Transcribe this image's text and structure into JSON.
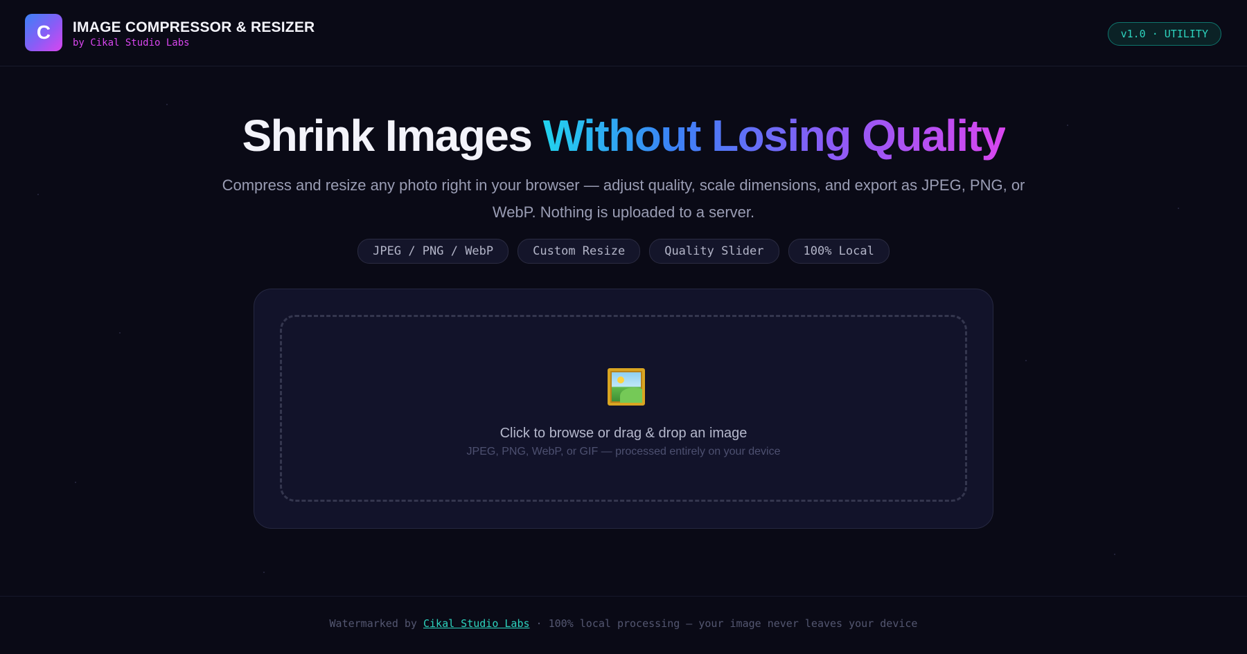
{
  "header": {
    "logo_letter": "C",
    "title": "IMAGE COMPRESSOR & RESIZER",
    "subtitle": "by Cikal Studio Labs",
    "version_badge": "v1.0 · UTILITY"
  },
  "hero": {
    "title_plain": "Shrink Images ",
    "title_gradient": "Without Losing Quality",
    "description": "Compress and resize any photo right in your browser — adjust quality, scale dimensions, and export as JPEG, PNG, or WebP. Nothing is uploaded to a server."
  },
  "features": [
    "JPEG / PNG / WebP",
    "Custom Resize",
    "Quality Slider",
    "100% Local"
  ],
  "dropzone": {
    "icon": "framed-picture-icon",
    "title": "Click to browse or drag & drop an image",
    "hint": "JPEG, PNG, WebP, or GIF — processed entirely on your device"
  },
  "footer": {
    "prefix": "Watermarked by ",
    "link_label": "Cikal Studio Labs",
    "suffix": " · 100% local processing — your image never leaves your device"
  },
  "colors": {
    "background": "#0a0a16",
    "accent_teal": "#2dd4bf",
    "accent_magenta": "#d946ef",
    "accent_violet": "#8b5cf6",
    "accent_cyan": "#22d3ee"
  }
}
